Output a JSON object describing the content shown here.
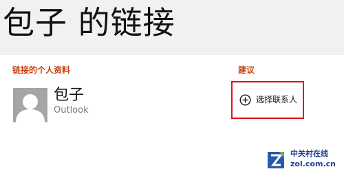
{
  "header": {
    "title": "包子 的链接"
  },
  "linked_profiles": {
    "heading": "链接的个人资料",
    "contact": {
      "name": "包子",
      "source": "Outlook"
    }
  },
  "suggestions": {
    "heading": "建议",
    "choose_contact_label": "选择联系人"
  },
  "watermark": {
    "name_cn": "中关村在线",
    "site": "zol.com.cn"
  },
  "colors": {
    "accent": "#c8410f",
    "highlight_border": "#e0101a",
    "header_bg": "#f1f1f1",
    "avatar_bg": "#a5a5a5"
  },
  "icons": {
    "avatar": "person-silhouette-icon",
    "choose_contact": "plus-circle-icon",
    "watermark_logo": "zol-logo-icon"
  }
}
